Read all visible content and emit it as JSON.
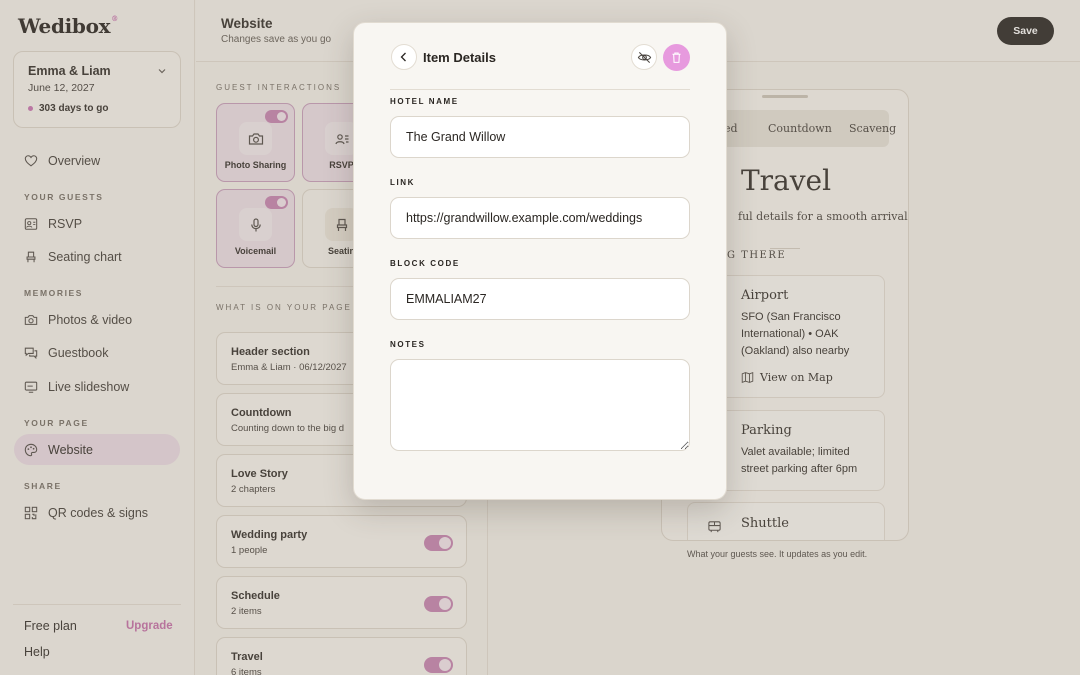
{
  "brand": {
    "name": "Wedibox",
    "mark": "®"
  },
  "event": {
    "names": "Emma & Liam",
    "date": "June 12, 2027",
    "countdown": "303 days to go"
  },
  "sidebar": {
    "overview": "Overview",
    "guests_heading": "YOUR GUESTS",
    "rsvp": "RSVP",
    "seating": "Seating chart",
    "memories_heading": "MEMORIES",
    "photos": "Photos & video",
    "guestbook": "Guestbook",
    "slideshow": "Live slideshow",
    "page_heading": "YOUR PAGE",
    "website": "Website",
    "share_heading": "SHARE",
    "qr": "QR codes & signs",
    "plan": "Free plan",
    "upgrade": "Upgrade",
    "help": "Help"
  },
  "header": {
    "title": "Website",
    "subtitle": "Changes save as you go",
    "save": "Save"
  },
  "editor": {
    "interactions_heading": "GUEST INTERACTIONS",
    "tiles": [
      {
        "label": "Photo Sharing",
        "icon": "camera-icon",
        "on": true
      },
      {
        "label": "RSVP",
        "icon": "rsvp-icon",
        "on": true
      },
      {
        "label": "Voicemail",
        "icon": "microphone-icon",
        "on": true
      },
      {
        "label": "Seatin",
        "icon": "seat-icon",
        "on": false
      }
    ],
    "page_heading": "WHAT IS ON YOUR PAGE",
    "sections": [
      {
        "title": "Header section",
        "sub": "Emma & Liam · 06/12/2027"
      },
      {
        "title": "Countdown",
        "sub": "Counting down to the big d"
      },
      {
        "title": "Love Story",
        "sub": "2 chapters"
      },
      {
        "title": "Wedding party",
        "sub": "1 people"
      },
      {
        "title": "Schedule",
        "sub": "2 items"
      },
      {
        "title": "Travel",
        "sub": "6 items"
      }
    ]
  },
  "preview": {
    "tabs": [
      "ed",
      "Countdown",
      "Scaveng"
    ],
    "title": "Travel",
    "subtitle": "ful details for a smooth arrival.",
    "section": "G THERE",
    "cards": [
      {
        "title": "Airport",
        "desc": "SFO (San Francisco International) • OAK (Oakland) also nearby",
        "link": "View on Map"
      },
      {
        "title": "Parking",
        "desc": "Valet available; limited street parking after 6pm"
      },
      {
        "title": "Shuttle",
        "icon": "bus-icon"
      }
    ],
    "caption": "What your guests see. It updates as you edit."
  },
  "modal": {
    "title": "Item Details",
    "hotel_label": "HOTEL NAME",
    "hotel_value": "The Grand Willow",
    "link_label": "LINK",
    "link_value": "https://grandwillow.example.com/weddings",
    "block_label": "BLOCK CODE",
    "block_value": "EMMALIAM27",
    "notes_label": "NOTES",
    "notes_value": ""
  },
  "colors": {
    "accent": "#c46aa8",
    "toggle": "#c580b0",
    "delete": "#e79ade",
    "save_bg": "#221f1c"
  }
}
